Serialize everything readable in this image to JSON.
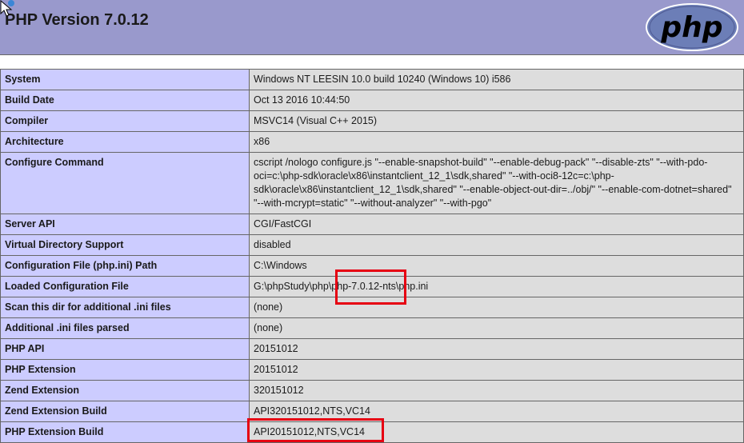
{
  "header": {
    "title": "PHP Version 7.0.12",
    "logo_text": "php",
    "bg_color": "#9999cc"
  },
  "table": {
    "rows": [
      {
        "label": "System",
        "value": "Windows NT LEESIN 10.0 build 10240 (Windows 10) i586"
      },
      {
        "label": "Build Date",
        "value": "Oct 13 2016 10:44:50"
      },
      {
        "label": "Compiler",
        "value": "MSVC14 (Visual C++ 2015)"
      },
      {
        "label": "Architecture",
        "value": "x86"
      },
      {
        "label": "Configure Command",
        "value": "cscript /nologo configure.js \"--enable-snapshot-build\" \"--enable-debug-pack\" \"--disable-zts\" \"--with-pdo-oci=c:\\php-sdk\\oracle\\x86\\instantclient_12_1\\sdk,shared\" \"--with-oci8-12c=c:\\php-sdk\\oracle\\x86\\instantclient_12_1\\sdk,shared\" \"--enable-object-out-dir=../obj/\" \"--enable-com-dotnet=shared\" \"--with-mcrypt=static\" \"--without-analyzer\" \"--with-pgo\""
      },
      {
        "label": "Server API",
        "value": "CGI/FastCGI"
      },
      {
        "label": "Virtual Directory Support",
        "value": "disabled"
      },
      {
        "label": "Configuration File (php.ini) Path",
        "value": "C:\\Windows"
      },
      {
        "label": "Loaded Configuration File",
        "value": "G:\\phpStudy\\php\\php-7.0.12-nts\\php.ini"
      },
      {
        "label": "Scan this dir for additional .ini files",
        "value": "(none)"
      },
      {
        "label": "Additional .ini files parsed",
        "value": "(none)"
      },
      {
        "label": "PHP API",
        "value": "20151012"
      },
      {
        "label": "PHP Extension",
        "value": "20151012"
      },
      {
        "label": "Zend Extension",
        "value": "320151012"
      },
      {
        "label": "Zend Extension Build",
        "value": "API320151012,NTS,VC14"
      },
      {
        "label": "PHP Extension Build",
        "value": "API20151012,NTS,VC14"
      }
    ]
  },
  "colors": {
    "label_bg": "#ccccff",
    "value_bg": "#dddddd",
    "highlight": "#e60012"
  }
}
